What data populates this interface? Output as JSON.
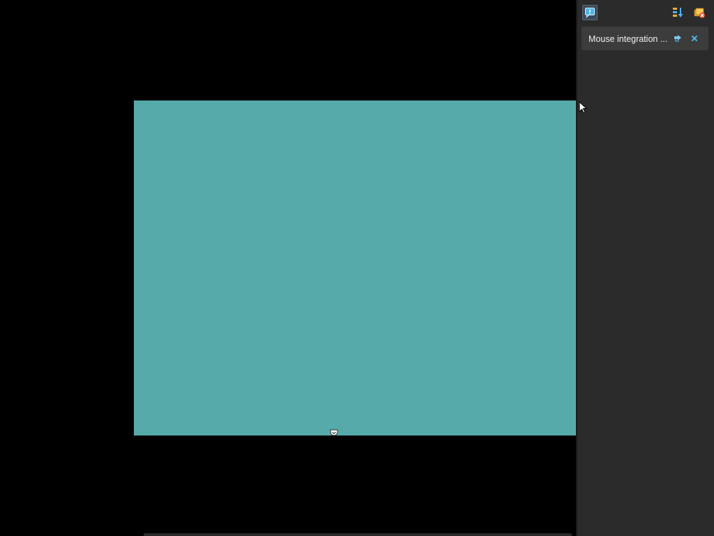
{
  "window": {
    "guest_screen_color": "#56aaaa",
    "background_color": "#000000"
  },
  "mini_toolbar": {
    "handle_icon": "chevron-down-icon"
  },
  "notification_center": {
    "background_color": "#2b2b2b",
    "toolbar": {
      "left_button_icon": "notification-center-icon",
      "sort_button_icon": "sort-icon",
      "dismiss_all_button_icon": "dismiss-all-icon"
    },
    "notices": [
      {
        "text": "Mouse integration ...",
        "help_icon": "details-toggle-icon",
        "close_icon": "close-icon"
      }
    ]
  },
  "cursor": {
    "icon": "mouse-pointer-icon"
  }
}
